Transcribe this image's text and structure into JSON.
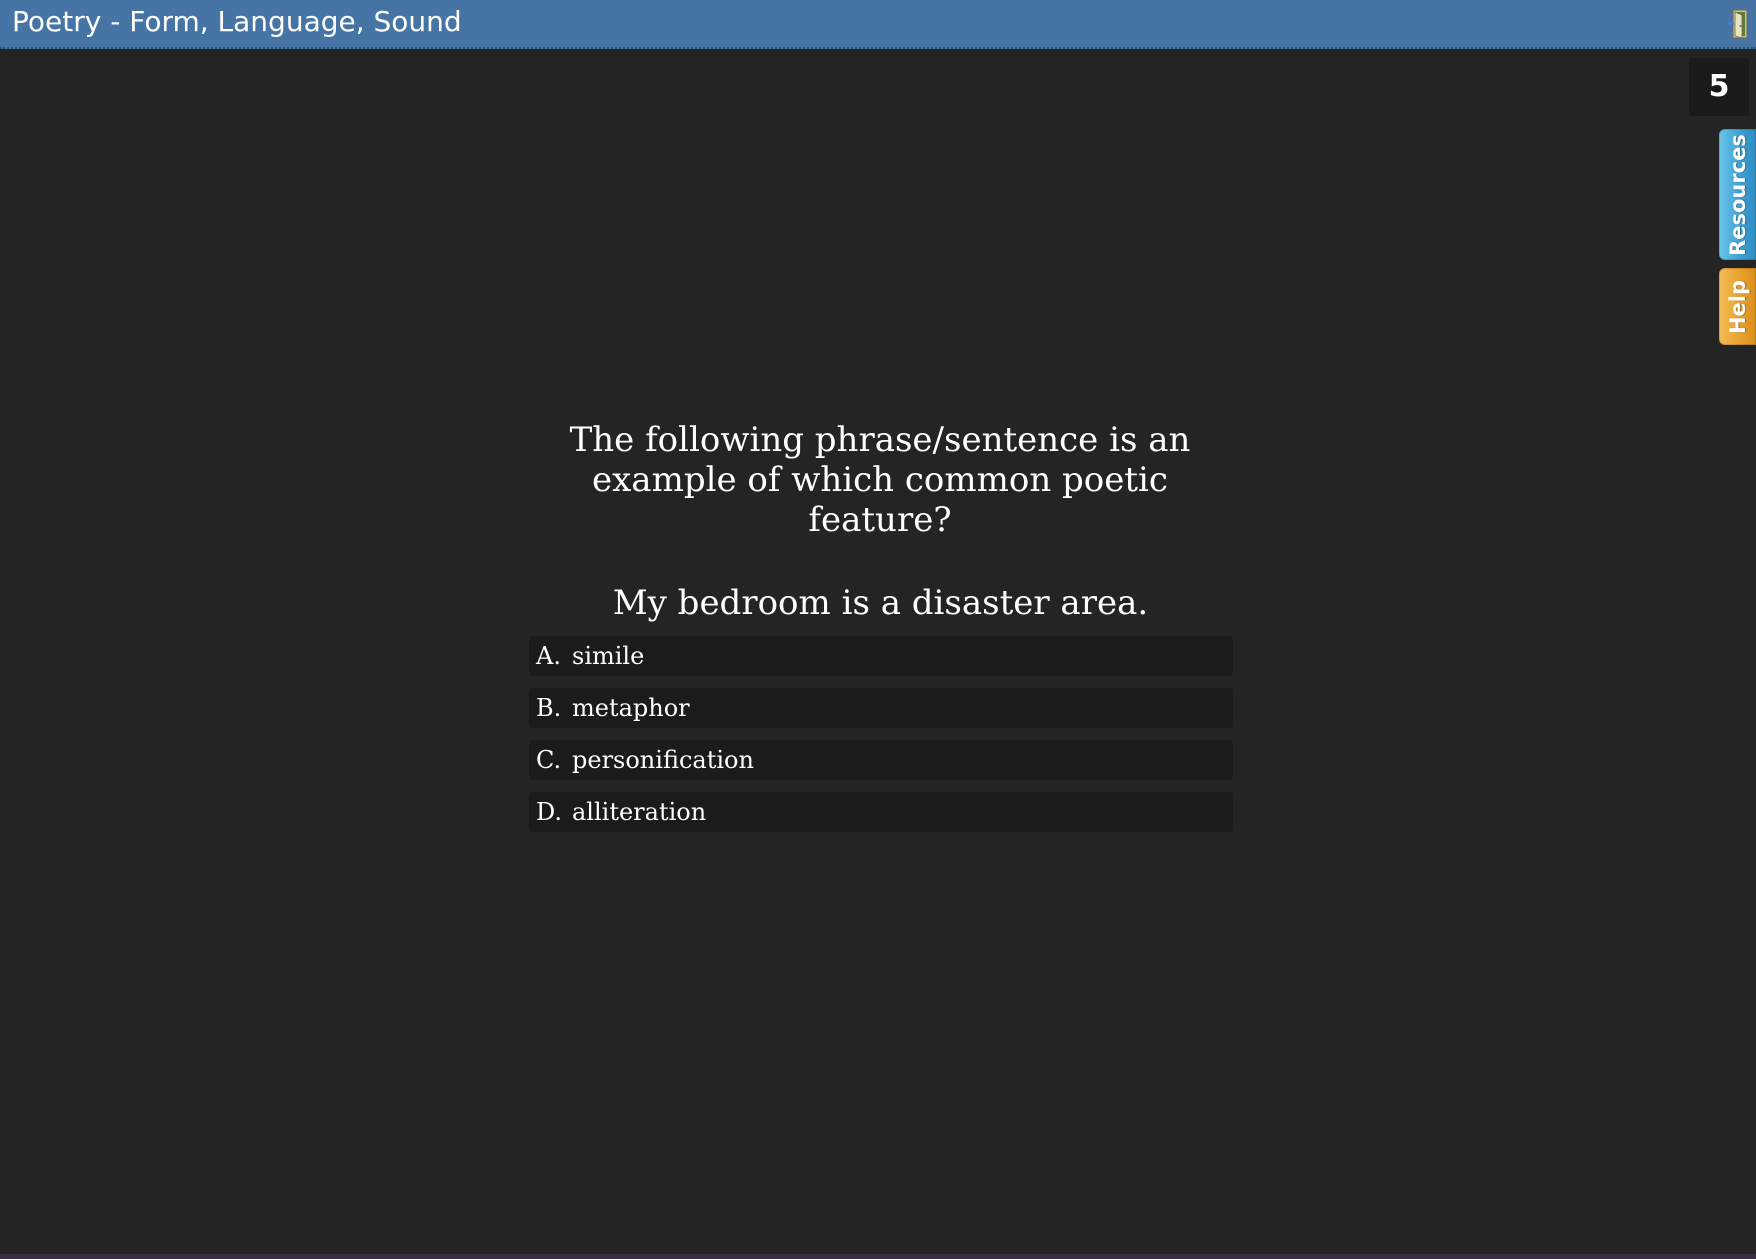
{
  "header": {
    "title": "Poetry - Form, Language, Sound",
    "exit_icon": "door-exit-icon"
  },
  "counter": {
    "value": "5"
  },
  "side_tabs": {
    "resources_label": "Resources",
    "help_label": "Help"
  },
  "question": {
    "prompt": "The following phrase/sentence is an example of which common poetic feature?",
    "phrase": "My bedroom is a disaster area."
  },
  "options": [
    {
      "letter": "A.",
      "text": "simile"
    },
    {
      "letter": "B.",
      "text": "metaphor"
    },
    {
      "letter": "C.",
      "text": "personification"
    },
    {
      "letter": "D.",
      "text": "alliteration"
    }
  ],
  "colors": {
    "header_bg": "#4574a5",
    "page_bg": "#242424",
    "option_bg": "#1b1b1b",
    "resources_tab": "#3c9fd3",
    "help_tab": "#e79f2c"
  }
}
